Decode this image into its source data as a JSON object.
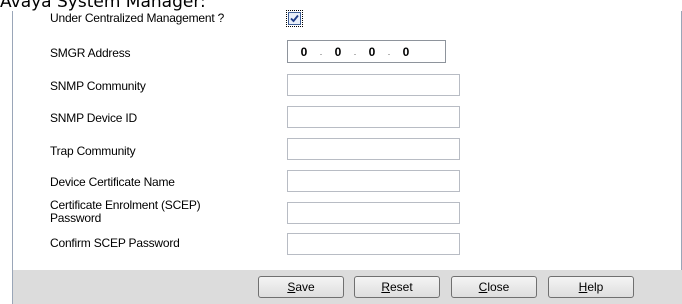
{
  "page_heading": "Avaya System Manager:",
  "form": {
    "centralized_label": "Under Centralized Management ?",
    "centralized_checked": true,
    "smgr_label": "SMGR Address",
    "smgr_octets": [
      "0",
      "0",
      "0",
      "0"
    ],
    "snmp_community_label": "SNMP Community",
    "snmp_community_value": "",
    "snmp_device_id_label": "SNMP Device ID",
    "snmp_device_id_value": "",
    "trap_community_label": "Trap Community",
    "trap_community_value": "",
    "device_cert_label": "Device Certificate Name",
    "device_cert_value": "",
    "scep_label_line1": "Certificate Enrolment (SCEP)",
    "scep_label_line2": "Password",
    "scep_value": "",
    "confirm_scep_label": "Confirm SCEP Password",
    "confirm_scep_value": ""
  },
  "buttons": {
    "save": {
      "accel": "S",
      "rest": "ave"
    },
    "reset": {
      "accel": "R",
      "rest": "eset"
    },
    "close": {
      "accel": "C",
      "rest": "lose"
    },
    "help": {
      "accel": "H",
      "rest": "elp"
    }
  }
}
